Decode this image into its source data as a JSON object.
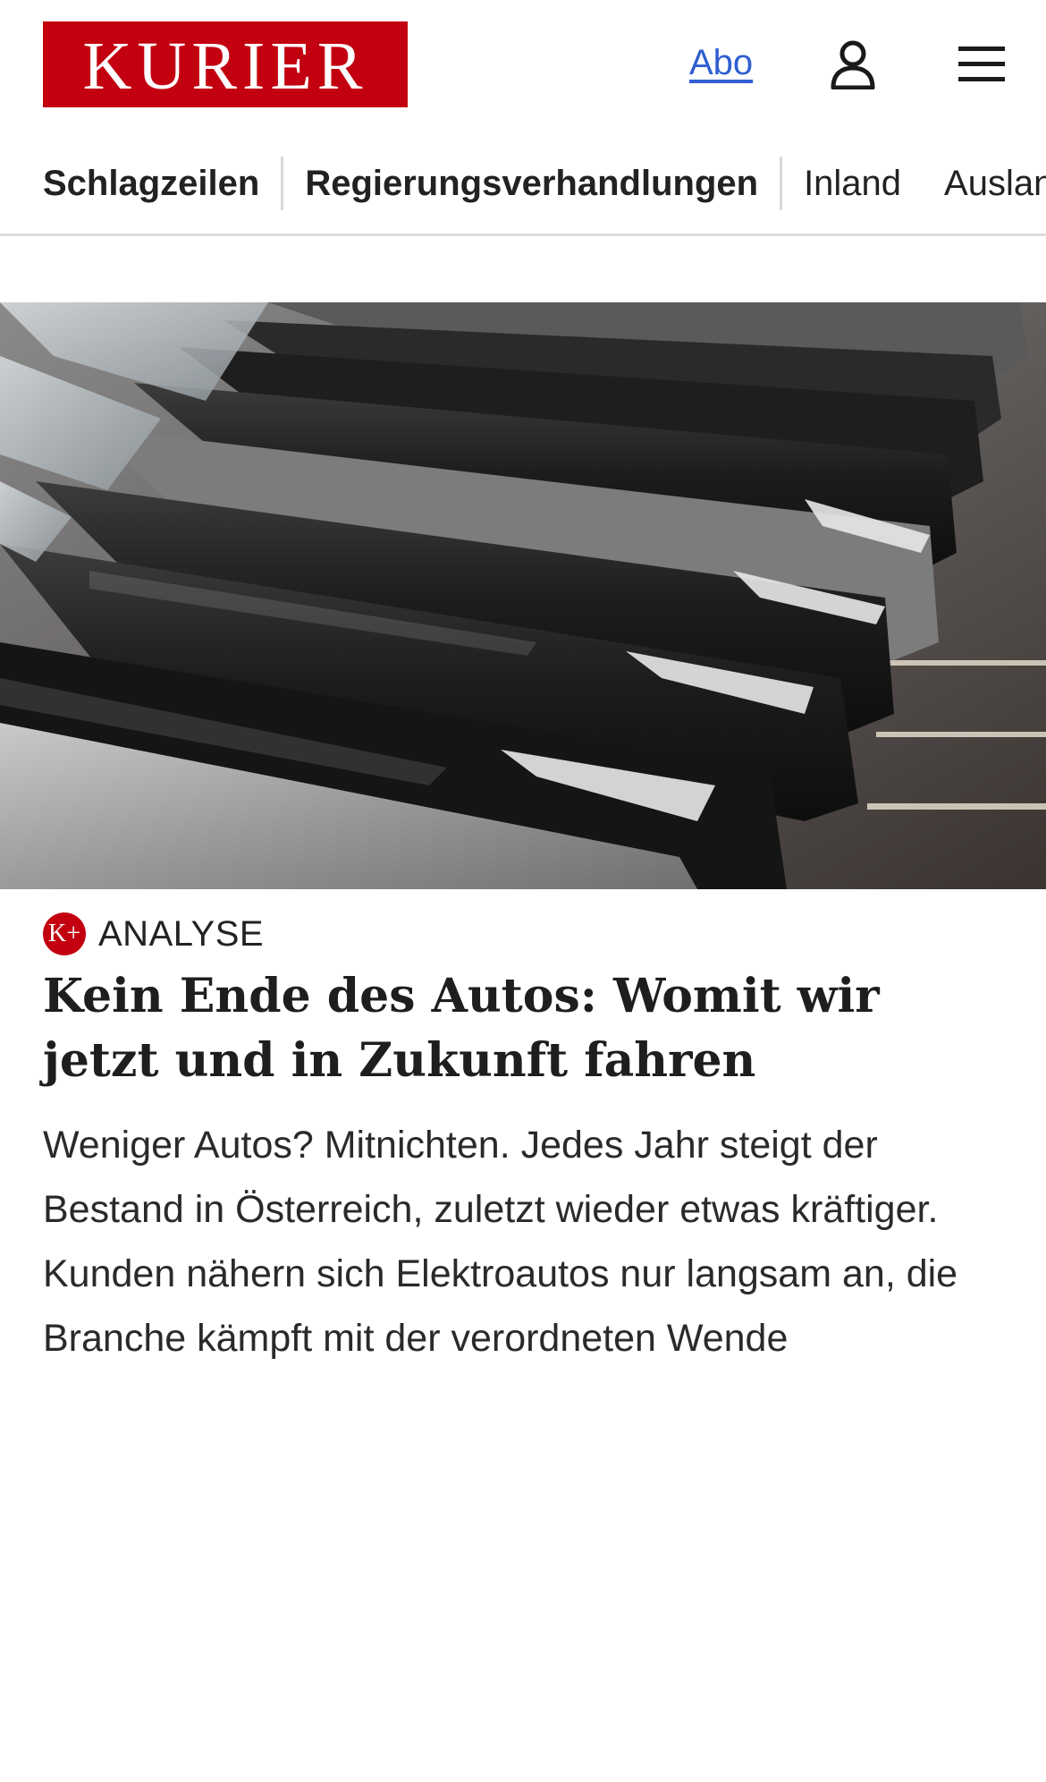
{
  "header": {
    "logo_text": "KURIER",
    "abo_link": "Abo",
    "user_icon": "user-icon",
    "menu_icon": "hamburger-menu-icon",
    "brand_color": "#c20010",
    "link_color": "#2f5fd0"
  },
  "nav": {
    "items": [
      {
        "label": "Schlagzeilen"
      },
      {
        "label": "Regierungsverhandlungen"
      },
      {
        "label": "Inland"
      },
      {
        "label": "Ausland"
      }
    ]
  },
  "article": {
    "image_alt": "row-of-parked-cars-photo",
    "kicker_badge": "K+",
    "kicker": "ANALYSE",
    "headline": "Kein Ende des Autos: Womit wir jetzt und in Zukunft fahren",
    "teaser": "Weniger Autos? Mitnichten. Jedes Jahr steigt der Bestand in Österreich, zuletzt wieder etwas kräftiger. Kunden nähern sich Elektroautos nur langsam an, die Branche kämpft mit der verordneten Wende"
  }
}
